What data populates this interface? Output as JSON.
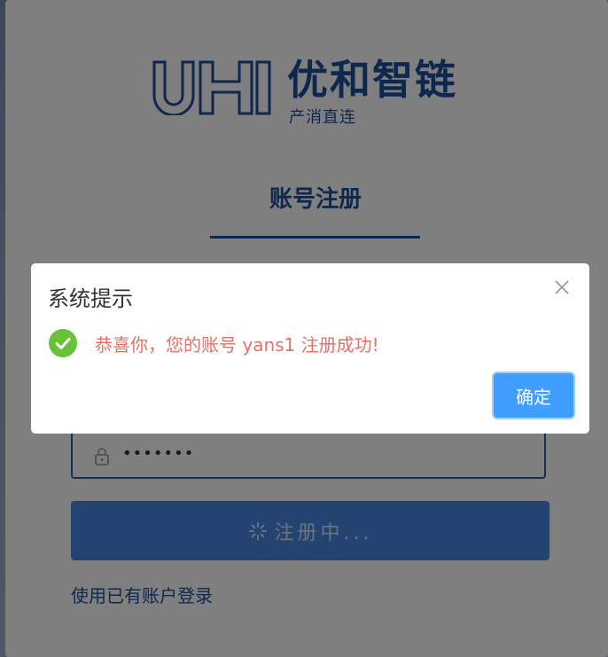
{
  "brand": {
    "mark": "UH",
    "title": "优和智链",
    "subtitle": "产消直连",
    "color": "#1d4f9c"
  },
  "form": {
    "tab_title": "账号注册",
    "password_value": "•••••••",
    "submit_label": "注册中...",
    "login_link": "使用已有账户登录"
  },
  "dialog": {
    "title": "系统提示",
    "message": "恭喜你，您的账号 yans1 注册成功!",
    "confirm_label": "确定",
    "message_color": "#ec6f62",
    "icons": [
      "success-check-icon",
      "close-icon"
    ]
  }
}
